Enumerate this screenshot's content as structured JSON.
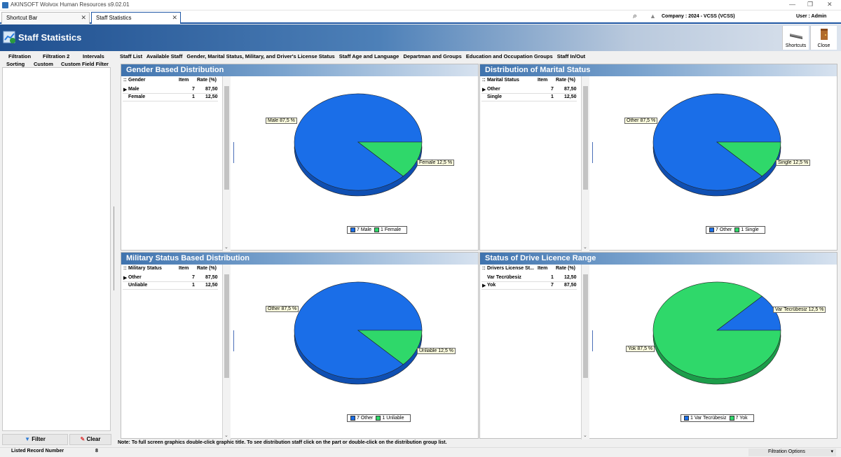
{
  "app": {
    "title": "AKINSOFT Wolvox Human Resources s9.02.01"
  },
  "tabs": [
    {
      "label": "Shortcut Bar"
    },
    {
      "label": "Staff Statistics"
    }
  ],
  "header": {
    "company": "Company : 2024 - VCSS (VCSS)",
    "user": "User : Admin"
  },
  "banner": {
    "title": "Staff Statistics",
    "shortcuts": "Shortcuts",
    "close": "Close"
  },
  "filter_tabs": [
    "Filtration",
    "Filtration 2",
    "Intervals",
    "Sorting",
    "Custom",
    "Custom Field Filter"
  ],
  "buttons": {
    "filter": "Filter",
    "clear": "Clear"
  },
  "status": {
    "listed_label": "Listed Record Number",
    "listed_count": "8",
    "filtration_options": "Filtration Options"
  },
  "stat_tabs": [
    "Staff List",
    "Available Staff",
    "Gender, Marital Status, Military, and Driver's License Status",
    "Staff Age and Language",
    "Departman and Groups",
    "Education and Occupation Groups",
    "Staff In/Out"
  ],
  "note": "Note: To full screen graphics double-click graphic title. To see distribution staff click on the part or double-click on the  distribution group list.",
  "panels": [
    {
      "title": "Gender Based Distribution",
      "col": "Gender",
      "item_col": "Item",
      "rate_col": "Rate (%)",
      "rows": [
        {
          "name": "Male",
          "item": "7",
          "rate": "87,50"
        },
        {
          "name": "Female",
          "item": "1",
          "rate": "12,50"
        }
      ],
      "labels": [
        "Male 87,5 %",
        "Female 12,5 %"
      ],
      "legend": [
        "7 Male",
        "1 Female"
      ]
    },
    {
      "title": "Distribution of Marital Status",
      "col": "Marital Status",
      "item_col": "Item",
      "rate_col": "Rate (%)",
      "rows": [
        {
          "name": "Other",
          "item": "7",
          "rate": "87,50"
        },
        {
          "name": "Single",
          "item": "1",
          "rate": "12,50"
        }
      ],
      "labels": [
        "Other 87,5 %",
        "Single 12,5 %"
      ],
      "legend": [
        "7 Other",
        "1 Single"
      ]
    },
    {
      "title": "Military Status Based Distribution",
      "col": "Military Status",
      "item_col": "Item",
      "rate_col": "Rate (%)",
      "rows": [
        {
          "name": "Other",
          "item": "7",
          "rate": "87,50"
        },
        {
          "name": "Unliable",
          "item": "1",
          "rate": "12,50"
        }
      ],
      "labels": [
        "Other 87,5 %",
        "Unliable 12,5 %"
      ],
      "legend": [
        "7 Other",
        "1 Unliable"
      ]
    },
    {
      "title": "Status of Drive Licence Range",
      "col": "Drivers License St...",
      "item_col": "Item",
      "rate_col": "Rate (%)",
      "rows": [
        {
          "name": "Var Tecrübesiz",
          "item": "1",
          "rate": "12,50"
        },
        {
          "name": "Yok",
          "item": "7",
          "rate": "87,50"
        }
      ],
      "labels": [
        "Var Tecrübesiz 12,5 %",
        "Yok 87,5 %"
      ],
      "legend": [
        "1 Var Tecrübesiz",
        "7 Yok"
      ]
    }
  ],
  "colors": {
    "blue": "#1a6ee8",
    "green": "#2fd86a",
    "header": "#3f73ae"
  },
  "chart_data": [
    {
      "type": "pie",
      "title": "Gender Based Distribution",
      "categories": [
        "Male",
        "Female"
      ],
      "values": [
        7,
        1
      ]
    },
    {
      "type": "pie",
      "title": "Distribution of Marital Status",
      "categories": [
        "Other",
        "Single"
      ],
      "values": [
        7,
        1
      ]
    },
    {
      "type": "pie",
      "title": "Military Status Based Distribution",
      "categories": [
        "Other",
        "Unliable"
      ],
      "values": [
        7,
        1
      ]
    },
    {
      "type": "pie",
      "title": "Status of Drive Licence Range",
      "categories": [
        "Var Tecrübesiz",
        "Yok"
      ],
      "values": [
        1,
        7
      ]
    }
  ]
}
